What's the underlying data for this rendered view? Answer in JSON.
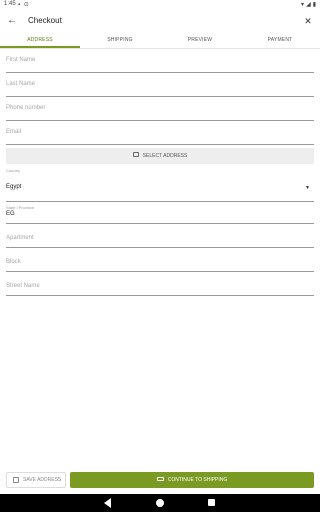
{
  "status_bar": {
    "time": "1:45",
    "left_icons": "▪ ⊙",
    "right_icons": [
      "wifi-icon",
      "signal-icon",
      "battery-icon"
    ]
  },
  "app_bar": {
    "title": "Checkout",
    "back_icon": "arrow-left-icon",
    "close_icon": "close-icon"
  },
  "tabs": [
    {
      "label": "ADDRESS",
      "active": true
    },
    {
      "label": "SHIPPING",
      "active": false
    },
    {
      "label": "PREVIEW",
      "active": false
    },
    {
      "label": "PAYMENT",
      "active": false
    }
  ],
  "form": {
    "first_name": {
      "placeholder": "First Name",
      "value": ""
    },
    "last_name": {
      "placeholder": "Last Name",
      "value": ""
    },
    "phone": {
      "placeholder": "Phone number",
      "value": ""
    },
    "email": {
      "placeholder": "Email",
      "value": ""
    },
    "select_address_label": "SELECT ADDRESS",
    "country": {
      "label": "Country",
      "value": "Egypt"
    },
    "state": {
      "label": "State / Province",
      "value": "EG"
    },
    "apartment": {
      "placeholder": "Apartment",
      "value": ""
    },
    "block": {
      "placeholder": "Block",
      "value": ""
    },
    "street_name": {
      "placeholder": "Street Name",
      "value": ""
    }
  },
  "actions": {
    "save_address_label": "SAVE ADDRESS",
    "continue_label": "CONTINUE TO SHIPPING"
  },
  "colors": {
    "accent": "#7a9a22",
    "accent_text": "#5a7a12",
    "nav_bar": "#000000"
  }
}
